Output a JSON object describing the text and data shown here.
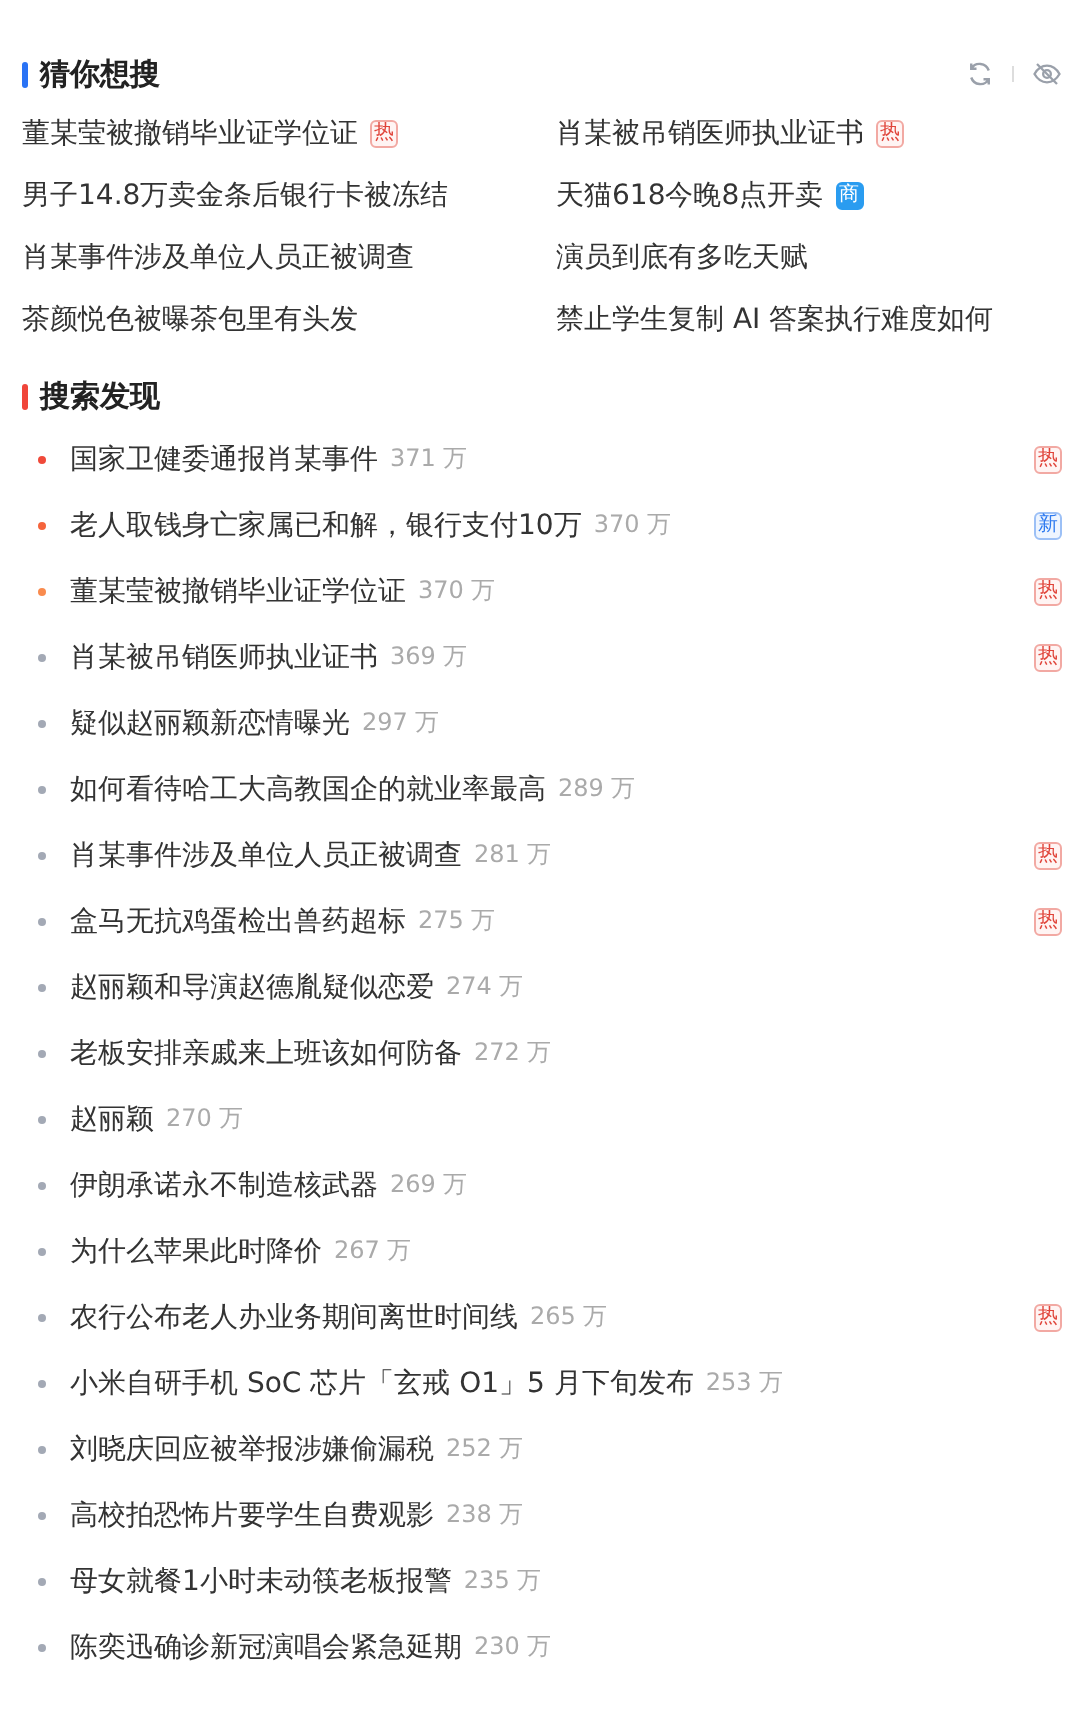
{
  "guess_section": {
    "title": "猜你想搜",
    "items": [
      {
        "text": "董某莹被撤销毕业证学位证",
        "badge": {
          "kind": "hot",
          "text": "热"
        }
      },
      {
        "text": "肖某被吊销医师执业证书",
        "badge": {
          "kind": "hot",
          "text": "热"
        }
      },
      {
        "text": "男子14.8万卖金条后银行卡被冻结"
      },
      {
        "text": "天猫618今晚8点开卖",
        "badge": {
          "kind": "ad",
          "text": "商"
        }
      },
      {
        "text": "肖某事件涉及单位人员正被调查"
      },
      {
        "text": "演员到底有多吃天赋"
      },
      {
        "text": "茶颜悦色被曝茶包里有头发"
      },
      {
        "text": "禁止学生复制 AI 答案执行难度如何"
      }
    ]
  },
  "discover_section": {
    "title": "搜索发现",
    "items": [
      {
        "text": "国家卫健委通报肖某事件",
        "count": "371 万",
        "color": "#f04a3a",
        "badge": {
          "kind": "hot",
          "text": "热"
        }
      },
      {
        "text": "老人取钱身亡家属已和解，银行支付10万",
        "count": "370 万",
        "color": "#f5643c",
        "badge": {
          "kind": "new",
          "text": "新"
        }
      },
      {
        "text": "董某莹被撤销毕业证学位证",
        "count": "370 万",
        "color": "#f98b4e",
        "badge": {
          "kind": "hot",
          "text": "热"
        }
      },
      {
        "text": "肖某被吊销医师执业证书",
        "count": "369 万",
        "color": "#a3a9b5",
        "badge": {
          "kind": "hot",
          "text": "热"
        }
      },
      {
        "text": "疑似赵丽颖新恋情曝光",
        "count": "297 万",
        "color": "#a3a9b5"
      },
      {
        "text": "如何看待哈工大高教国企的就业率最高",
        "count": "289 万",
        "color": "#a3a9b5"
      },
      {
        "text": "肖某事件涉及单位人员正被调查",
        "count": "281 万",
        "color": "#a3a9b5",
        "badge": {
          "kind": "hot",
          "text": "热"
        }
      },
      {
        "text": "盒马无抗鸡蛋检出兽药超标",
        "count": "275 万",
        "color": "#a3a9b5",
        "badge": {
          "kind": "hot",
          "text": "热"
        }
      },
      {
        "text": "赵丽颖和导演赵德胤疑似恋爱",
        "count": "274 万",
        "color": "#a3a9b5"
      },
      {
        "text": "老板安排亲戚来上班该如何防备",
        "count": "272 万",
        "color": "#a3a9b5"
      },
      {
        "text": "赵丽颖",
        "count": "270 万",
        "color": "#a3a9b5"
      },
      {
        "text": "伊朗承诺永不制造核武器",
        "count": "269 万",
        "color": "#a3a9b5"
      },
      {
        "text": "为什么苹果此时降价",
        "count": "267 万",
        "color": "#a3a9b5"
      },
      {
        "text": "农行公布老人办业务期间离世时间线",
        "count": "265 万",
        "color": "#a3a9b5",
        "badge": {
          "kind": "hot",
          "text": "热"
        }
      },
      {
        "text": "小米自研手机 SoC 芯片「玄戒 O1」5 月下旬发布",
        "count": "253 万",
        "color": "#a3a9b5"
      },
      {
        "text": "刘晓庆回应被举报涉嫌偷漏税",
        "count": "252 万",
        "color": "#a3a9b5"
      },
      {
        "text": "高校拍恐怖片要学生自费观影",
        "count": "238 万",
        "color": "#a3a9b5"
      },
      {
        "text": "母女就餐1小时未动筷老板报警",
        "count": "235 万",
        "color": "#a3a9b5"
      },
      {
        "text": "陈奕迅确诊新冠演唱会紧急延期",
        "count": "230 万",
        "color": "#a3a9b5"
      }
    ]
  }
}
